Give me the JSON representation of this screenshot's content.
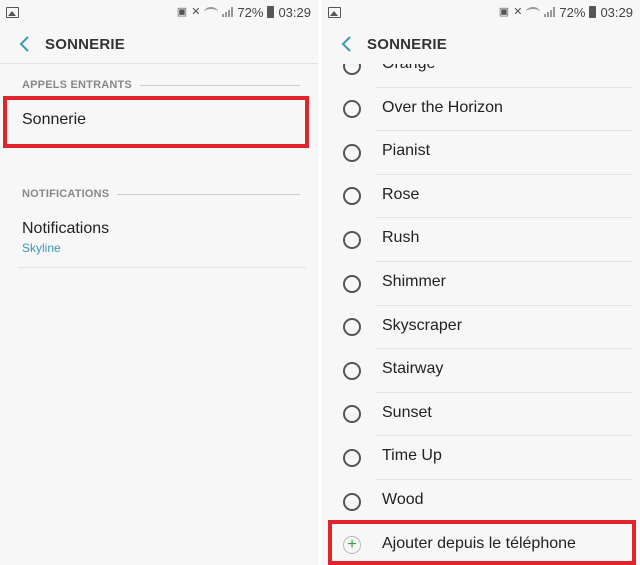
{
  "status": {
    "battery": "72%",
    "time": "03:29"
  },
  "left": {
    "title": "SONNERIE",
    "section1": "APPELS ENTRANTS",
    "ringtone_label": "Sonnerie",
    "section2": "NOTIFICATIONS",
    "notif_label": "Notifications",
    "notif_value": "Skyline"
  },
  "right": {
    "title": "SONNERIE",
    "items": [
      "Orange",
      "Over the Horizon",
      "Pianist",
      "Rose",
      "Rush",
      "Shimmer",
      "Skyscraper",
      "Stairway",
      "Sunset",
      "Time Up",
      "Wood"
    ],
    "add_label": "Ajouter depuis le téléphone"
  },
  "colors": {
    "highlight": "#e0232d",
    "accent": "#3a9ab5",
    "add_icon": "#2ea43c"
  }
}
